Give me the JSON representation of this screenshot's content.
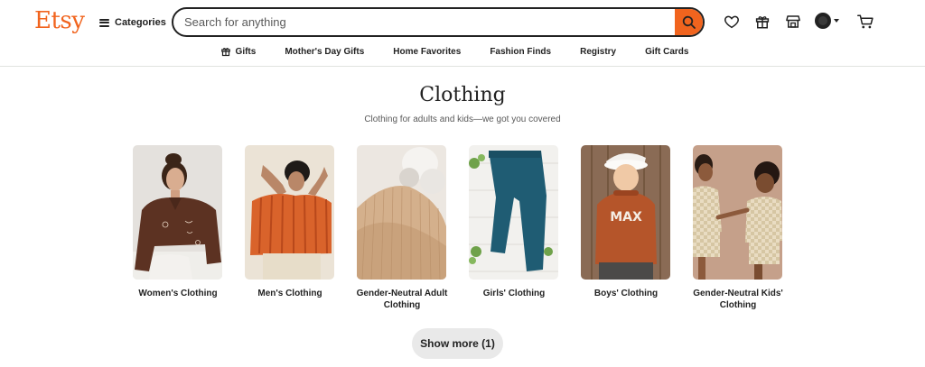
{
  "header": {
    "logo": "Etsy",
    "categories_label": "Categories",
    "search": {
      "placeholder": "Search for anything",
      "value": ""
    },
    "icons": [
      "heart-icon",
      "gift-icon",
      "shop-icon",
      "avatar",
      "cart-icon"
    ],
    "accent_color": "#f1641e"
  },
  "nav": {
    "items": [
      {
        "label": "Gifts",
        "icon": "gift-icon"
      },
      {
        "label": "Mother's Day Gifts"
      },
      {
        "label": "Home Favorites"
      },
      {
        "label": "Fashion Finds"
      },
      {
        "label": "Registry"
      },
      {
        "label": "Gift Cards"
      }
    ]
  },
  "main": {
    "title": "Clothing",
    "subtitle": "Clothing for adults and kids—we got you covered",
    "categories": [
      {
        "label": "Women's Clothing"
      },
      {
        "label": "Men's Clothing"
      },
      {
        "label": "Gender-Neutral Adult Clothing"
      },
      {
        "label": "Girls' Clothing"
      },
      {
        "label": "Boys' Clothing",
        "shirt_text": "MAX"
      },
      {
        "label": "Gender-Neutral Kids' Clothing"
      }
    ],
    "show_more_label": "Show more (1)"
  }
}
